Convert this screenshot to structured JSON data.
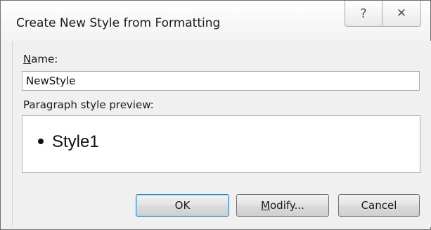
{
  "window": {
    "title": "Create New Style from Formatting",
    "help_glyph": "?",
    "close_glyph": "✕"
  },
  "name_field": {
    "label_mnemonic": "N",
    "label_rest": "ame:",
    "value": "NewStyle"
  },
  "preview": {
    "label": "Paragraph style preview:",
    "text": "Style1"
  },
  "buttons": {
    "ok_label": "OK",
    "modify_mnemonic": "M",
    "modify_rest": "odify...",
    "cancel_label": "Cancel"
  },
  "colors": {
    "dialog_bg": "#f0f0f0",
    "default_button_border": "#3c7fb1"
  }
}
